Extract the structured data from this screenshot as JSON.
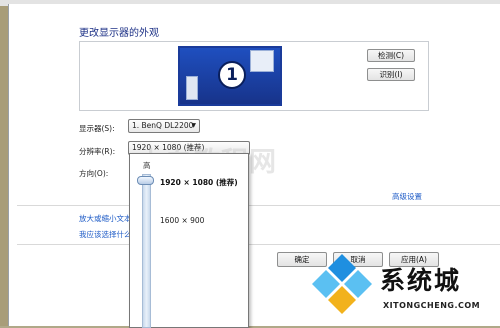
{
  "window": {
    "title": "更改显示器的外观"
  },
  "preview": {
    "monitor_number": "1"
  },
  "buttons": {
    "detect": "检测(C)",
    "identify": "识别(I)",
    "ok": "确定",
    "cancel": "取消",
    "apply": "应用(A)"
  },
  "fields": {
    "display_label": "显示器(S):",
    "display_value": "1. BenQ DL2200",
    "resolution_label": "分辨率(R):",
    "resolution_value": "1920 × 1080 (推荐)",
    "orientation_label": "方向(O):"
  },
  "links": {
    "advanced": "高级设置",
    "text_size": "放大或缩小文本",
    "which": "我应该选择什么"
  },
  "resolution_popup": {
    "high_label": "高",
    "options": [
      "1920 × 1080 (推荐)",
      "1600 × 900"
    ],
    "selected_index": 0
  },
  "watermark": "小白教程网",
  "brand": {
    "name": "系统城",
    "url": "XITONGCHENG.COM"
  },
  "colors": {
    "accent": "#1e3287",
    "link": "#1f5cc7",
    "monitor_blue": "#1f4fbf",
    "brand_blue": "#1f8fe0"
  },
  "icons": [
    "monitor-icon",
    "dropdown-arrow-icon",
    "slider-thumb-icon",
    "brand-logo-icon"
  ]
}
